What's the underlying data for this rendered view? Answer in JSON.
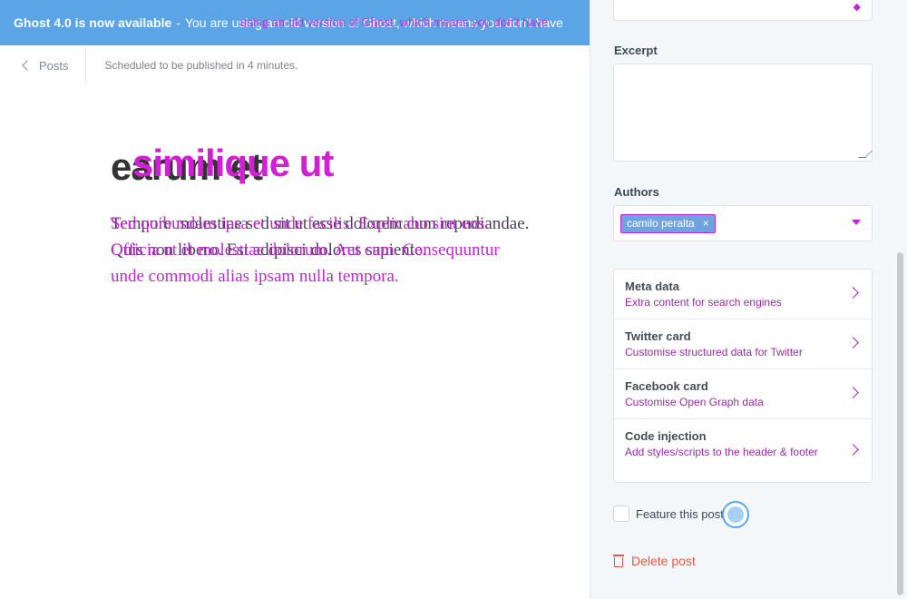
{
  "banner": {
    "strong": "Ghost 4.0 is now available",
    "separator": "-",
    "message": "You are using an old version of Ghost, which means you don't have",
    "ghost_overlay": "using an old version of Ghost, which means you don't have"
  },
  "header": {
    "back_label": "Posts",
    "status": "Scheduled to be published in 4 minutes.",
    "status_overlay": "Scheduled to be published in 4 minutes."
  },
  "post": {
    "title": "earum et",
    "title_overlay": "similique ut",
    "body_line1": "Tempore molestiae sed sit ut esse dolorem cum repudiandae.",
    "body_line2": "Quis non libero. Est adipisci dolores sapiente.",
    "body_overlay1": "Sed quibusdam ipsa et unde facilis. Explicabo sint eos.",
    "body_overlay2": "Officia ut et molestiae dolorum. Aut cum. Consequuntur",
    "body_line3": "unde commodi alias ipsam nulla tempora."
  },
  "settings": {
    "excerpt_label": "Excerpt",
    "authors_label": "Authors",
    "author_name": "camilo peralta",
    "author_remove": "×",
    "menu": [
      {
        "title": "Meta data",
        "desc": "Extra content for search engines"
      },
      {
        "title": "Twitter card",
        "desc": "Customise structured data for Twitter"
      },
      {
        "title": "Facebook card",
        "desc": "Customise Open Graph data"
      },
      {
        "title": "Code injection",
        "desc": "Add styles/scripts to the header & footer"
      }
    ],
    "feature_label": "Feature this post",
    "delete_label": "Delete post"
  }
}
